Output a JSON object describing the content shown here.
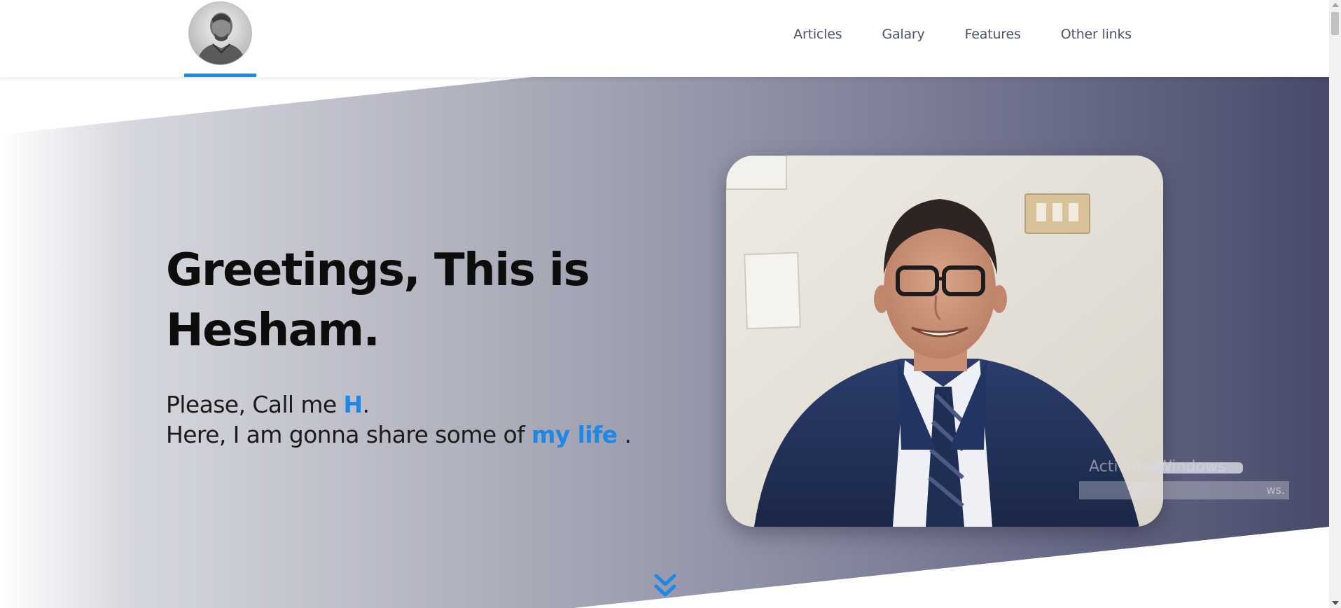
{
  "nav": {
    "logo_alt": "Hesham avatar",
    "items": [
      {
        "label": "Articles"
      },
      {
        "label": "Galary"
      },
      {
        "label": "Features"
      },
      {
        "label": "Other links"
      }
    ]
  },
  "hero": {
    "headline": "Greetings, This is Hesham.",
    "line1_prefix": "Please, Call me ",
    "line1_accent": "H",
    "line1_suffix": ".",
    "line2_prefix": "Here, I am gonna share some of ",
    "line2_accent": "my life",
    "line2_suffix": " .",
    "portrait_alt": "Portrait photo of Hesham in a suit",
    "scroll_icon": "double-chevron-down-icon"
  },
  "watermark": {
    "line1": "Activate Windows",
    "line2": "ws."
  },
  "colors": {
    "accent": "#1e88e5",
    "hero_dark": "#4b4e6d",
    "hero_light": "#ffffff",
    "text": "#0d0d0d",
    "nav_text": "#4a5566"
  }
}
